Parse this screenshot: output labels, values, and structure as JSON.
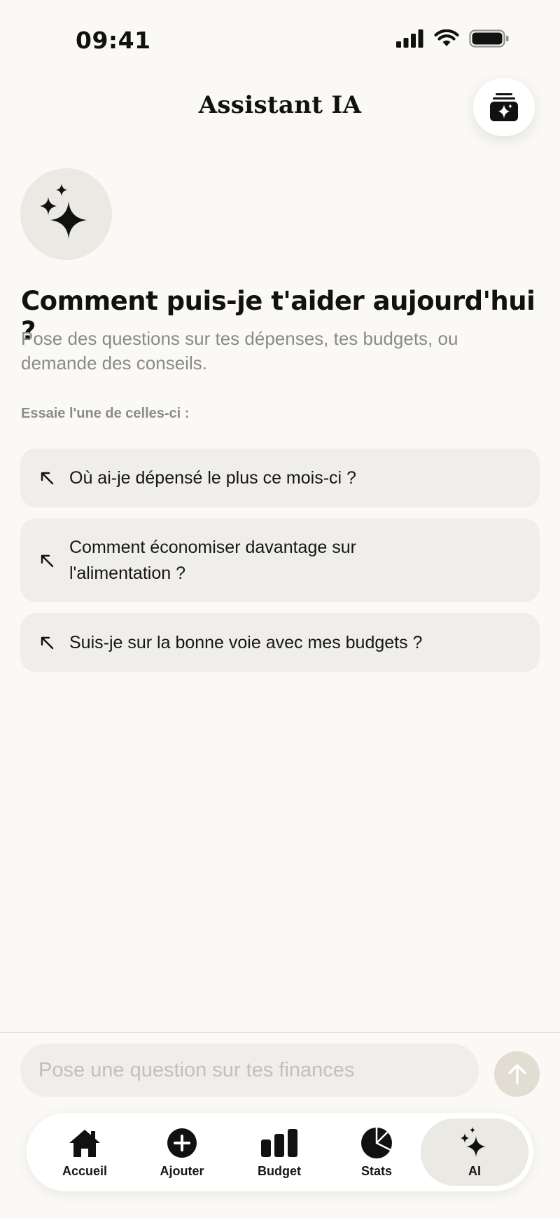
{
  "status_bar": {
    "time": "09:41",
    "icons": [
      "signal-icon",
      "wifi-icon",
      "battery-icon"
    ]
  },
  "header": {
    "title": "Assistant IA",
    "history_icon": "chat-history-icon"
  },
  "welcome": {
    "icon": "sparkles-icon",
    "title": "Comment puis-je t'aider aujourd'hui ?",
    "subtitle": "Pose des questions sur tes dépenses, tes budgets, ou demande des conseils."
  },
  "suggestions": {
    "label": "Essaie l'une de celles-ci :",
    "items": [
      {
        "text": "Où ai-je dépensé le plus ce mois-ci ?"
      },
      {
        "text": "Comment économiser davantage sur l'alimentation ?"
      },
      {
        "text": "Suis-je sur la bonne voie avec mes budgets ?"
      }
    ]
  },
  "chat": {
    "placeholder": "Pose une question sur tes finances",
    "value": ""
  },
  "tabs": [
    {
      "label": "Accueil",
      "icon": "home-icon",
      "active": false
    },
    {
      "label": "Ajouter",
      "icon": "add-circle-icon",
      "active": false
    },
    {
      "label": "Budget",
      "icon": "bar-chart-icon",
      "active": false
    },
    {
      "label": "Stats",
      "icon": "pie-chart-icon",
      "active": false
    },
    {
      "label": "AI",
      "icon": "sparkles-icon",
      "active": true
    }
  ],
  "colors": {
    "background": "#faf9f6",
    "card": "#efeeea",
    "text": "#111111",
    "muted": "#8a8a87",
    "send_button": "#e2ddd3"
  }
}
